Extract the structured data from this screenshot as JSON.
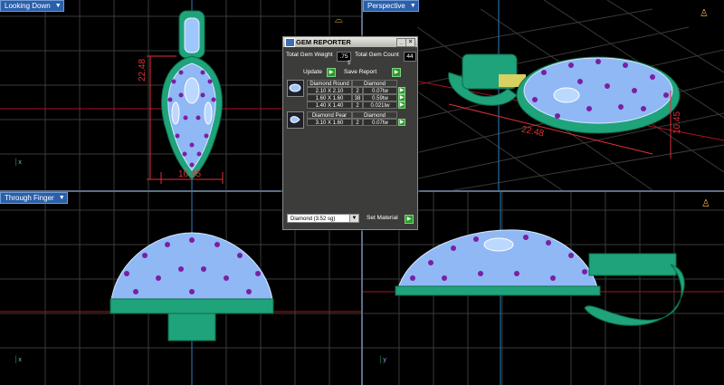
{
  "viewports": [
    {
      "label": "Looking Down",
      "axis": "x",
      "dims": {
        "vertical": "22.48",
        "horizontal": "10.45"
      }
    },
    {
      "label": "Perspective",
      "dims": {
        "length": "22.48",
        "width": "10.45"
      }
    },
    {
      "label": "Through Finger",
      "axis": "x"
    },
    {
      "label": "",
      "axis": "y"
    }
  ],
  "colors": {
    "metal": "#1fa37a",
    "gem": "#9fc7ff",
    "accent_gem": "#7b1fa2",
    "dimension": "#e0303a",
    "grid": "#3a3a3a"
  },
  "panel": {
    "title": "GEM REPORTER",
    "total_weight_label": "Total Gem Weight",
    "total_weight_value": ".75",
    "total_count_label": "Total Gem Count",
    "total_count_value": "44",
    "marker": "$",
    "update_label": "Update",
    "save_label": "Save Report",
    "groups": [
      {
        "name": "Diamond Round",
        "material": "Diamond",
        "rows": [
          {
            "size": "2.10 X 2.10",
            "count": "2",
            "weight": "0.07tw"
          },
          {
            "size": "1.60 X 1.60",
            "count": "38",
            "weight": "0.59tw"
          },
          {
            "size": "1.40 X 1.40",
            "count": "2",
            "weight": "0.021tw"
          }
        ]
      },
      {
        "name": "Diamond Pear",
        "material": "Diamond",
        "rows": [
          {
            "size": "3.10 X 1.60",
            "count": "2",
            "weight": "0.07tw"
          }
        ]
      }
    ],
    "material_select": "Diamond   (3.52 sg)",
    "set_material_label": "Set Material"
  }
}
